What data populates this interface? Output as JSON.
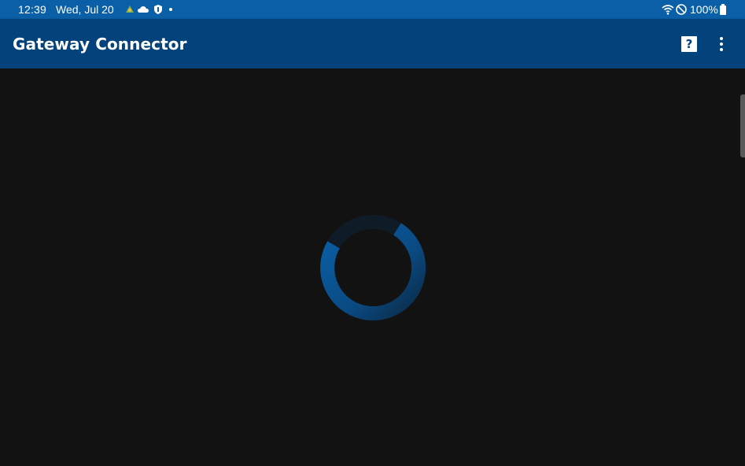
{
  "status_bar": {
    "time": "12:39",
    "date": "Wed, Jul 20",
    "battery": "100%",
    "notification_icons": [
      "app-notification-icon",
      "cloud-icon",
      "shield-icon"
    ],
    "system_icons": [
      "wifi-icon",
      "do-not-disturb-icon",
      "battery-icon"
    ],
    "color": "#0a5fa6"
  },
  "app_bar": {
    "title": "Gateway Connector",
    "help_label": "?",
    "color": "#03427a"
  },
  "content": {
    "state": "loading",
    "spinner_color": "#0a5fa6",
    "background": "#121212"
  }
}
